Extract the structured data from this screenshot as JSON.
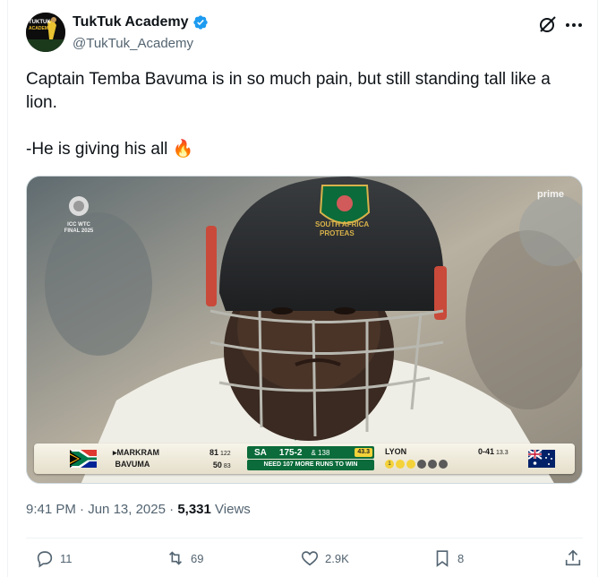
{
  "author": {
    "display_name": "TukTuk Academy",
    "handle": "@TukTuk_Academy",
    "avatar_text": "TUKTUK ACADEMY",
    "verified": true
  },
  "tweet": {
    "line1": "Captain Temba Bavuma is in so much pain, but still standing tall like a lion.",
    "line2": "-He is giving his all",
    "emoji": "🔥"
  },
  "media": {
    "broadcast_logo": "ICC WTC FINAL 2025",
    "prime_logo": "prime",
    "helmet_text": "SOUTH AFRICA",
    "helmet_sub": "PROTEAS",
    "scoreboard": {
      "batter1_name": "MARKRAM",
      "batter1_runs": "81",
      "batter1_balls": "122",
      "batter2_name": "BAVUMA",
      "batter2_runs": "50",
      "batter2_balls": "83",
      "team": "SA",
      "score": "175-2",
      "extra": "& 138",
      "overs": "43.3",
      "need_text": "NEED 107 MORE RUNS TO WIN",
      "bowler_name": "LYON",
      "bowler_fig": "0-41",
      "bowler_overs": "13.3",
      "ball_marks": [
        "1",
        "",
        "",
        "",
        "",
        ""
      ]
    }
  },
  "meta": {
    "time": "9:41 PM",
    "date": "Jun 13, 2025",
    "views_count": "5,331",
    "views_label": "Views"
  },
  "actions": {
    "replies": "11",
    "reposts": "69",
    "likes": "2.9K",
    "bookmarks": "8"
  },
  "colors": {
    "text_primary": "#0f1419",
    "text_secondary": "#536471",
    "verified_blue": "#1d9bf0",
    "scoreboard_green": "#0b6b3a"
  }
}
